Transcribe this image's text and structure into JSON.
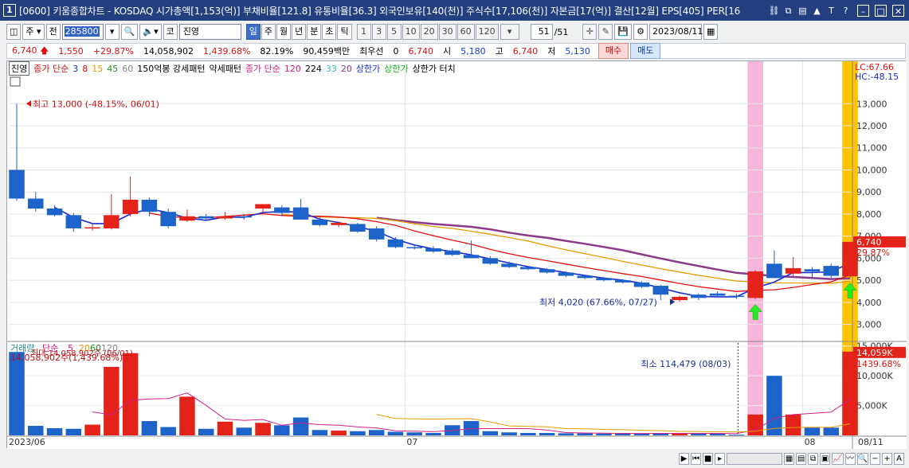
{
  "window": {
    "number": "1",
    "title": "[0600] 키움종합차트 - KOSDAQ 시가총액[1,153(억)] 부채비율[121.8] 유통비율[36.3] 외국인보유[140(천)] 주식수[17,106(천)] 자본금[17(억)] 결산[12월] EPS[405] PER[16"
  },
  "toolbar": {
    "period_select": "주",
    "prev_label": "전",
    "code": "285800",
    "market_badge": "코",
    "stock_name": "진영",
    "intervals": [
      "일",
      "주",
      "월",
      "년",
      "분",
      "초",
      "틱"
    ],
    "active_interval": "일",
    "minute_options": [
      "1",
      "3",
      "5",
      "10",
      "20",
      "30",
      "60",
      "120"
    ],
    "page": "51",
    "page_total": "/51",
    "date": "2023/08/11"
  },
  "quote": {
    "price": "6,740",
    "change": "1,550",
    "change_pct": "+29.87%",
    "volume": "14,058,902",
    "volume_pct": "1,439.68%",
    "ratio": "82.19%",
    "trade_amount": "90,459백만",
    "best_label": "최우선",
    "best_value": "0",
    "last": "6,740",
    "open_label": "시",
    "open": "5,180",
    "high_label": "고",
    "high": "6,740",
    "low_label": "저",
    "low": "5,130",
    "buy_label": "매수",
    "sell_label": "매도"
  },
  "legend": {
    "stock_tag": "진영",
    "ma_label": "종가 단순",
    "ma_periods": [
      "3",
      "8",
      "15",
      "45",
      "60"
    ],
    "pattern1": "150억봉 강세패턴",
    "pattern2": "약세패턴",
    "ma2_label": "종가 단순",
    "ma2_periods": [
      "120",
      "224",
      "33",
      "20"
    ],
    "limit_up": "상한가",
    "limit_up2": "상한가",
    "limit_touch": "상한가 터치"
  },
  "price_panel": {
    "lc_label": "LC:67.66",
    "hc_label": "HC:-48.15",
    "price_tag": "6,740",
    "pct_tag": "29.87%",
    "high_note": "최고 13,000 (-48.15%, 06/01)",
    "low_note": "최저 4,020 (67.66%, 07/27)"
  },
  "volume_panel": {
    "legend_label": "거래량",
    "ma_label": "단순",
    "ma_periods": [
      "5",
      "20",
      "60",
      "120"
    ],
    "max_note": "14,058,902주(1,439.68%)",
    "max_note2": "최대 14,058,902주 (06/01)",
    "min_note": "최소 114,479 (08/03)",
    "vol_tag": "14,059K",
    "vol_pct_tag": "1439.68%"
  },
  "x_labels": [
    "2023/06",
    "07",
    "08",
    "08/11"
  ],
  "chart_data": {
    "type": "candlestick",
    "y_ticks": [
      3000,
      4000,
      5000,
      6000,
      7000,
      8000,
      9000,
      10000,
      11000,
      12000,
      13000
    ],
    "y_tick_labels": [
      "3,000",
      "4,000",
      "5,000",
      "6,000",
      "7,000",
      "8,000",
      "9,000",
      "10,000",
      "11,000",
      "12,000",
      "13,000"
    ],
    "ylim": [
      2300,
      14200
    ],
    "vol_ticks": [
      5000,
      10000,
      15000
    ],
    "vol_tick_labels": [
      "5,000K",
      "10,000K",
      "15,000K"
    ],
    "vol_ylim": [
      0,
      15500
    ],
    "candles": [
      {
        "o": 10000,
        "h": 13000,
        "l": 8600,
        "c": 8700,
        "v": 14000
      },
      {
        "o": 8700,
        "h": 9000,
        "l": 8100,
        "c": 8250,
        "v": 1600
      },
      {
        "o": 8250,
        "h": 8400,
        "l": 7900,
        "c": 7950,
        "v": 1200
      },
      {
        "o": 7950,
        "h": 8050,
        "l": 7200,
        "c": 7350,
        "v": 1100
      },
      {
        "o": 7350,
        "h": 7550,
        "l": 7250,
        "c": 7400,
        "v": 1800
      },
      {
        "o": 7350,
        "h": 8900,
        "l": 7300,
        "c": 7950,
        "v": 11500
      },
      {
        "o": 8000,
        "h": 9700,
        "l": 7900,
        "c": 8650,
        "v": 13800
      },
      {
        "o": 8650,
        "h": 8750,
        "l": 7900,
        "c": 8100,
        "v": 2400
      },
      {
        "o": 8100,
        "h": 8250,
        "l": 7350,
        "c": 7450,
        "v": 1400
      },
      {
        "o": 7700,
        "h": 8200,
        "l": 7650,
        "c": 7900,
        "v": 6500
      },
      {
        "o": 7900,
        "h": 8000,
        "l": 7750,
        "c": 7800,
        "v": 1100
      },
      {
        "o": 7800,
        "h": 8100,
        "l": 7750,
        "c": 7900,
        "v": 2300
      },
      {
        "o": 7900,
        "h": 8000,
        "l": 7750,
        "c": 7850,
        "v": 1300
      },
      {
        "o": 8250,
        "h": 8400,
        "l": 8000,
        "c": 8450,
        "v": 2100
      },
      {
        "o": 8300,
        "h": 8400,
        "l": 7900,
        "c": 8050,
        "v": 1700
      },
      {
        "o": 8300,
        "h": 8700,
        "l": 7750,
        "c": 7750,
        "v": 3000
      },
      {
        "o": 7750,
        "h": 7850,
        "l": 7450,
        "c": 7500,
        "v": 900
      },
      {
        "o": 7500,
        "h": 7650,
        "l": 7400,
        "c": 7600,
        "v": 800
      },
      {
        "o": 7550,
        "h": 7600,
        "l": 7150,
        "c": 7200,
        "v": 700
      },
      {
        "o": 7350,
        "h": 7450,
        "l": 6750,
        "c": 6850,
        "v": 900
      },
      {
        "o": 6850,
        "h": 6950,
        "l": 6450,
        "c": 6500,
        "v": 600
      },
      {
        "o": 6500,
        "h": 6600,
        "l": 6400,
        "c": 6450,
        "v": 500
      },
      {
        "o": 6450,
        "h": 6550,
        "l": 6250,
        "c": 6300,
        "v": 400
      },
      {
        "o": 6350,
        "h": 6450,
        "l": 6100,
        "c": 6150,
        "v": 1700
      },
      {
        "o": 6150,
        "h": 6800,
        "l": 6000,
        "c": 6000,
        "v": 2400
      },
      {
        "o": 6000,
        "h": 6100,
        "l": 5700,
        "c": 5750,
        "v": 700
      },
      {
        "o": 5750,
        "h": 5850,
        "l": 5550,
        "c": 5600,
        "v": 500
      },
      {
        "o": 5600,
        "h": 5650,
        "l": 5450,
        "c": 5500,
        "v": 400
      },
      {
        "o": 5500,
        "h": 5550,
        "l": 5300,
        "c": 5350,
        "v": 400
      },
      {
        "o": 5350,
        "h": 5400,
        "l": 5150,
        "c": 5200,
        "v": 350
      },
      {
        "o": 5200,
        "h": 5250,
        "l": 5050,
        "c": 5100,
        "v": 350
      },
      {
        "o": 5100,
        "h": 5150,
        "l": 4950,
        "c": 5000,
        "v": 300
      },
      {
        "o": 5000,
        "h": 5050,
        "l": 4850,
        "c": 4900,
        "v": 300
      },
      {
        "o": 4900,
        "h": 4950,
        "l": 4650,
        "c": 4700,
        "v": 300
      },
      {
        "o": 4750,
        "h": 4800,
        "l": 4100,
        "c": 4350,
        "v": 400
      },
      {
        "o": 4100,
        "h": 4300,
        "l": 4020,
        "c": 4250,
        "v": 350
      },
      {
        "o": 4350,
        "h": 4400,
        "l": 4100,
        "c": 4200,
        "v": 300
      },
      {
        "o": 4400,
        "h": 4500,
        "l": 4250,
        "c": 4300,
        "v": 300
      },
      {
        "o": 4300,
        "h": 4400,
        "l": 4150,
        "c": 4250,
        "v": 114
      },
      {
        "o": 4200,
        "h": 5450,
        "l": 4150,
        "c": 5400,
        "v": 3500
      },
      {
        "o": 5750,
        "h": 6350,
        "l": 5100,
        "c": 5100,
        "v": 10000
      },
      {
        "o": 5300,
        "h": 6050,
        "l": 5200,
        "c": 5550,
        "v": 3500
      },
      {
        "o": 5500,
        "h": 5600,
        "l": 5100,
        "c": 5400,
        "v": 1300
      },
      {
        "o": 5650,
        "h": 5750,
        "l": 5100,
        "c": 5200,
        "v": 1300
      },
      {
        "o": 5180,
        "h": 6740,
        "l": 5130,
        "c": 6740,
        "v": 14059
      }
    ]
  },
  "colors": {
    "up": "#e32219",
    "down": "#1d63c9",
    "highlight_pink": "#f7b5db",
    "highlight_orange": "#ffc400",
    "arrow_green": "#22ee22"
  }
}
